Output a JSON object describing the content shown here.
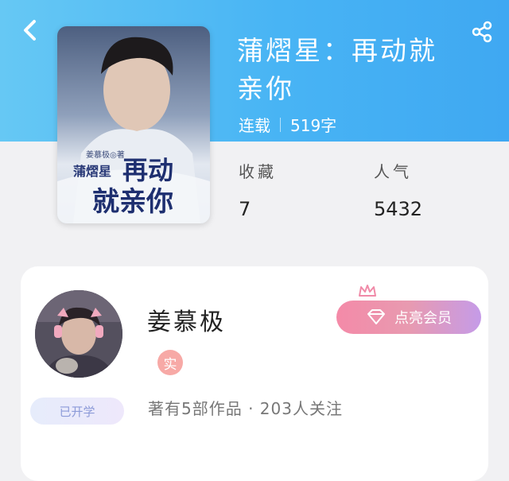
{
  "header": {
    "back_icon": "chevron-left-icon",
    "share_icon": "share-icon"
  },
  "book": {
    "title": "蒲熠星：再动就亲你",
    "status": "连载",
    "word_count": "519字",
    "cover": {
      "author_tag": "姜慕极◎著",
      "series_text": "蒲熠星",
      "title_line1": "再动",
      "title_line2": "就亲你"
    }
  },
  "stats": [
    {
      "label": "收藏",
      "value": "7"
    },
    {
      "label": "人气",
      "value": "5432"
    }
  ],
  "author": {
    "name": "姜慕极",
    "verified_label": "实",
    "member_button": "点亮会员",
    "opened_badge": "已开学",
    "works_line": "著有5部作品 · 203人关注"
  },
  "colors": {
    "header": "#48b4f4",
    "member_gradient_start": "#f48aa8",
    "member_gradient_end": "#c59be8"
  }
}
